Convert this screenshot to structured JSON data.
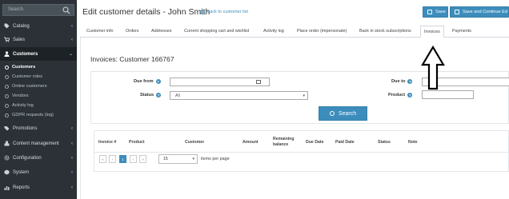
{
  "sidebar": {
    "search_placeholder": "Search",
    "items": [
      {
        "label": "Catalog"
      },
      {
        "label": "Sales"
      },
      {
        "label": "Customers"
      },
      {
        "label": "Promotions"
      },
      {
        "label": "Content management"
      },
      {
        "label": "Configuration"
      },
      {
        "label": "System"
      },
      {
        "label": "Reports"
      }
    ],
    "customers_sub": [
      {
        "label": "Customers"
      },
      {
        "label": "Customer roles"
      },
      {
        "label": "Online customers"
      },
      {
        "label": "Vendors"
      },
      {
        "label": "Activity log"
      },
      {
        "label": "GDPR requests (log)"
      }
    ]
  },
  "header": {
    "title": "Edit customer details - John Smith",
    "back_link": "back to customer list",
    "save_label": "Save",
    "save_continue_label": "Save and Continue Ed"
  },
  "tabs": [
    {
      "label": "Customer info"
    },
    {
      "label": "Orders"
    },
    {
      "label": "Addresses"
    },
    {
      "label": "Current shopping cart and wishlist"
    },
    {
      "label": "Activity log"
    },
    {
      "label": "Place order (impersonate)"
    },
    {
      "label": "Back in stock subscriptions"
    },
    {
      "label": "Invoices"
    },
    {
      "label": "Payments"
    }
  ],
  "invoices": {
    "title": "Invoices: Customer 166767",
    "filters": {
      "due_from_label": "Due from",
      "due_to_label": "Due to",
      "status_label": "Status",
      "status_value": "All",
      "product_label": "Product"
    },
    "search_label": "Search",
    "grid": {
      "columns": [
        "Invoice #",
        "Product",
        "Customer",
        "Amount",
        "Remaining balance",
        "Due Date",
        "Paid Date",
        "Status",
        "Note"
      ],
      "page_current": "1",
      "page_size": "15",
      "items_per_page": "items per page"
    }
  },
  "colors": {
    "sidebar_bg": "#2b3137",
    "accent": "#3c8dbc"
  }
}
